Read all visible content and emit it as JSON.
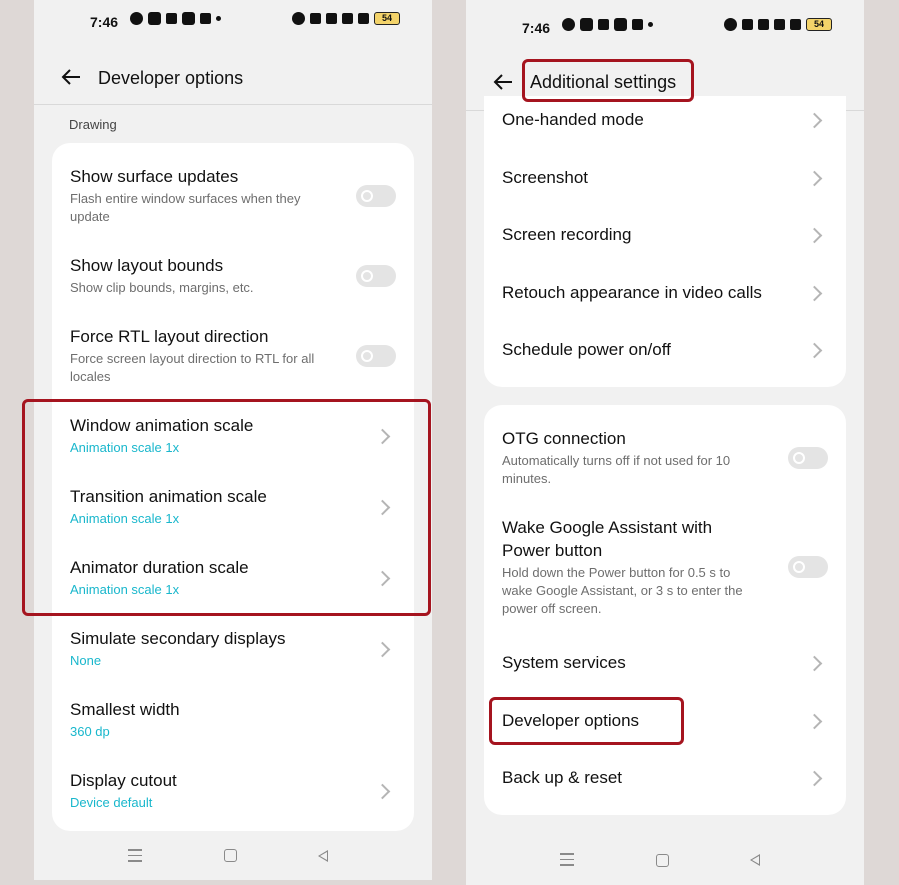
{
  "left_screen": {
    "status": {
      "time": "7:46",
      "battery": "54"
    },
    "appbar": {
      "title": "Developer options"
    },
    "section_label": "Drawing",
    "items": [
      {
        "title": "Show surface updates",
        "subtitle": "Flash entire window surfaces when they update",
        "control": "toggle"
      },
      {
        "title": "Show layout bounds",
        "subtitle": "Show clip bounds, margins, etc.",
        "control": "toggle"
      },
      {
        "title": "Force RTL layout direction",
        "subtitle": "Force screen layout direction to RTL for all locales",
        "control": "toggle"
      },
      {
        "title": "Window animation scale",
        "subtitle": "Animation scale 1x",
        "control": "chevron"
      },
      {
        "title": "Transition animation scale",
        "subtitle": "Animation scale 1x",
        "control": "chevron"
      },
      {
        "title": "Animator duration scale",
        "subtitle": "Animation scale 1x",
        "control": "chevron"
      },
      {
        "title": "Simulate secondary displays",
        "subtitle": "None",
        "control": "chevron"
      },
      {
        "title": "Smallest width",
        "subtitle": "360 dp",
        "control": "none"
      },
      {
        "title": "Display cutout",
        "subtitle": "Device default",
        "control": "chevron"
      }
    ]
  },
  "right_screen": {
    "status": {
      "time": "7:46",
      "battery": "54"
    },
    "appbar": {
      "title": "Additional settings"
    },
    "group1": [
      {
        "title": "One-handed mode"
      },
      {
        "title": "Screenshot"
      },
      {
        "title": "Screen recording"
      },
      {
        "title": "Retouch appearance in video calls"
      },
      {
        "title": "Schedule power on/off"
      }
    ],
    "group2": [
      {
        "title": "OTG connection",
        "subtitle": "Automatically turns off if not used for 10 minutes.",
        "control": "toggle"
      },
      {
        "title": "Wake Google Assistant with Power button",
        "subtitle": "Hold down the Power button for 0.5 s to wake Google Assistant, or 3 s to enter the power off screen.",
        "control": "toggle"
      },
      {
        "title": "System services",
        "control": "chevron"
      },
      {
        "title": "Developer options",
        "control": "chevron"
      },
      {
        "title": "Back up & reset",
        "control": "chevron"
      }
    ]
  },
  "colors": {
    "accent": "#19b7cc",
    "highlight": "#a5141f",
    "card": "#ffffff",
    "background": "#f1f1f1"
  },
  "icons": [
    "back-arrow-icon",
    "chevron-right-icon",
    "toggle-switch",
    "menu-nav-icon",
    "home-nav-icon",
    "back-nav-icon"
  ]
}
